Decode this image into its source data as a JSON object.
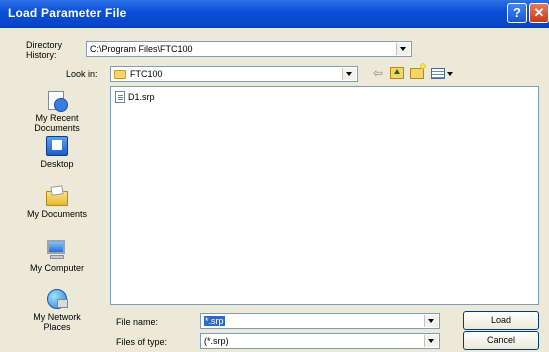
{
  "window": {
    "title": "Load Parameter File",
    "help_glyph": "?",
    "close_glyph": "✕"
  },
  "directory_history": {
    "label": "Directory\nHistory:",
    "value": "C:\\Program Files\\FTC100"
  },
  "look_in": {
    "label": "Look in:",
    "value": "FTC100"
  },
  "toolbar": {
    "back_glyph": "⇦"
  },
  "places": [
    {
      "label": "My Recent\nDocuments",
      "icon": "recent-documents-icon"
    },
    {
      "label": "Desktop",
      "icon": "desktop-icon"
    },
    {
      "label": "My Documents",
      "icon": "my-documents-icon"
    },
    {
      "label": "My Computer",
      "icon": "my-computer-icon"
    },
    {
      "label": "My Network\nPlaces",
      "icon": "network-places-icon"
    }
  ],
  "files": [
    {
      "name": "D1.srp"
    }
  ],
  "file_name": {
    "label": "File name:",
    "value": "*.srp"
  },
  "file_type": {
    "label": "Files of type:",
    "value": "(*.srp)"
  },
  "buttons": {
    "load": "Load",
    "cancel": "Cancel"
  },
  "colors": {
    "titlebar": "#0a4fd6",
    "background": "#ece9d8",
    "selection": "#316ac5"
  }
}
